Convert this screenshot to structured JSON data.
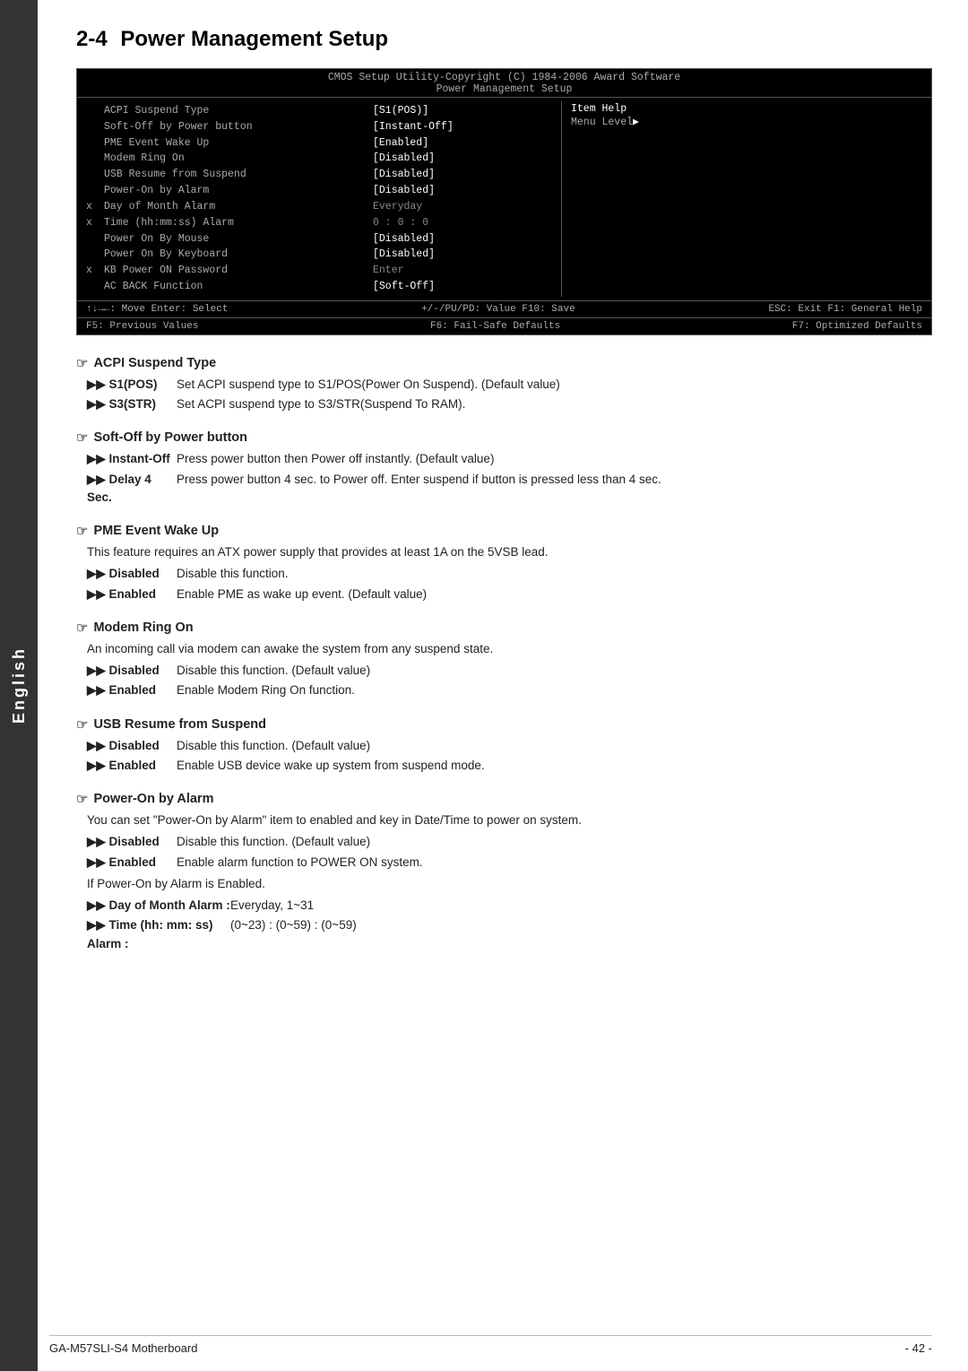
{
  "side_label": "English",
  "chapter": {
    "number": "2-4",
    "title": "Power Management Setup"
  },
  "bios": {
    "header_line1": "CMOS Setup Utility-Copyright (C) 1984-2006 Award Software",
    "header_line2": "Power Management Setup",
    "rows": [
      {
        "prefix": " ",
        "label": "ACPI Suspend Type",
        "value": "[S1(POS)]"
      },
      {
        "prefix": " ",
        "label": "Soft-Off by Power button",
        "value": "[Instant-Off]"
      },
      {
        "prefix": " ",
        "label": "PME Event Wake Up",
        "value": "[Enabled]"
      },
      {
        "prefix": " ",
        "label": "Modem Ring On",
        "value": "[Disabled]"
      },
      {
        "prefix": " ",
        "label": "USB Resume from Suspend",
        "value": "[Disabled]"
      },
      {
        "prefix": " ",
        "label": "Power-On by Alarm",
        "value": "[Disabled]"
      },
      {
        "prefix": "x",
        "label": "Day of Month Alarm",
        "value": "Everyday",
        "dim": true
      },
      {
        "prefix": "x",
        "label": "Time (hh:mm:ss) Alarm",
        "value": "0 : 0 : 0",
        "dim": true
      },
      {
        "prefix": " ",
        "label": "Power On By Mouse",
        "value": "[Disabled]"
      },
      {
        "prefix": " ",
        "label": "Power On By Keyboard",
        "value": "[Disabled]"
      },
      {
        "prefix": "x",
        "label": "KB Power ON Password",
        "value": "Enter",
        "dim": true
      },
      {
        "prefix": " ",
        "label": "AC BACK Function",
        "value": "[Soft-Off]"
      }
    ],
    "item_help_title": "Item Help",
    "menu_level_label": "Menu Level",
    "menu_level_arrow": "▶",
    "footer": {
      "row1_left": "↑↓→←: Move    Enter: Select",
      "row1_mid": "+/-/PU/PD: Value    F10: Save",
      "row1_right": "ESC: Exit    F1: General Help",
      "row2_left": "F5: Previous Values",
      "row2_mid": "F6: Fail-Safe Defaults",
      "row2_right": "F7: Optimized Defaults"
    }
  },
  "sections": [
    {
      "id": "acpi-suspend-type",
      "heading": "ACPI Suspend Type",
      "items": [
        {
          "bullet": "▶▶ S1(POS)",
          "text": "Set ACPI suspend type to S1/POS(Power On Suspend). (Default value)"
        },
        {
          "bullet": "▶▶ S3(STR)",
          "text": "Set ACPI suspend type to S3/STR(Suspend To RAM)."
        }
      ]
    },
    {
      "id": "soft-off-power",
      "heading": "Soft-Off by Power button",
      "items": [
        {
          "bullet": "▶▶ Instant-Off",
          "text": "Press power button then Power off instantly. (Default value)"
        },
        {
          "bullet": "▶▶ Delay 4 Sec.",
          "text": "Press power button 4 sec. to Power off. Enter suspend if button is pressed less than 4 sec.",
          "multiline": true
        }
      ]
    },
    {
      "id": "pme-event-wake",
      "heading": "PME Event Wake Up",
      "plain": "This feature requires an ATX power supply that provides at least 1A on the 5VSB lead.",
      "items": [
        {
          "bullet": "▶▶ Disabled",
          "text": "Disable this function."
        },
        {
          "bullet": "▶▶ Enabled",
          "text": "Enable PME as wake up event. (Default value)"
        }
      ]
    },
    {
      "id": "modem-ring-on",
      "heading": "Modem Ring On",
      "plain": "An incoming call via modem can awake the system from any suspend state.",
      "items": [
        {
          "bullet": "▶▶ Disabled",
          "text": "Disable this function. (Default value)"
        },
        {
          "bullet": "▶▶ Enabled",
          "text": "Enable Modem Ring On function."
        }
      ]
    },
    {
      "id": "usb-resume-suspend",
      "heading": "USB Resume from Suspend",
      "items": [
        {
          "bullet": "▶▶ Disabled",
          "text": "Disable this function. (Default value)"
        },
        {
          "bullet": "▶▶ Enabled",
          "text": "Enable USB device wake up system from suspend mode."
        }
      ]
    },
    {
      "id": "power-on-alarm",
      "heading": "Power-On by Alarm",
      "plain": "You can set \"Power-On by Alarm\" item to enabled and key in Date/Time to power on system.",
      "items": [
        {
          "bullet": "▶▶ Disabled",
          "text": "Disable this function. (Default value)"
        },
        {
          "bullet": "▶▶ Enabled",
          "text": "Enable alarm function to POWER ON system."
        }
      ],
      "extra_plain": "If Power-On by Alarm is Enabled.",
      "extra_items": [
        {
          "bullet": "▶▶ Day of Month Alarm :",
          "text": "Everyday, 1~31"
        },
        {
          "bullet": "▶▶ Time (hh: mm: ss) Alarm :",
          "text": "(0~23) : (0~59) : (0~59)"
        }
      ]
    }
  ],
  "footer": {
    "model": "GA-M57SLI-S4 Motherboard",
    "page": "- 42 -"
  }
}
